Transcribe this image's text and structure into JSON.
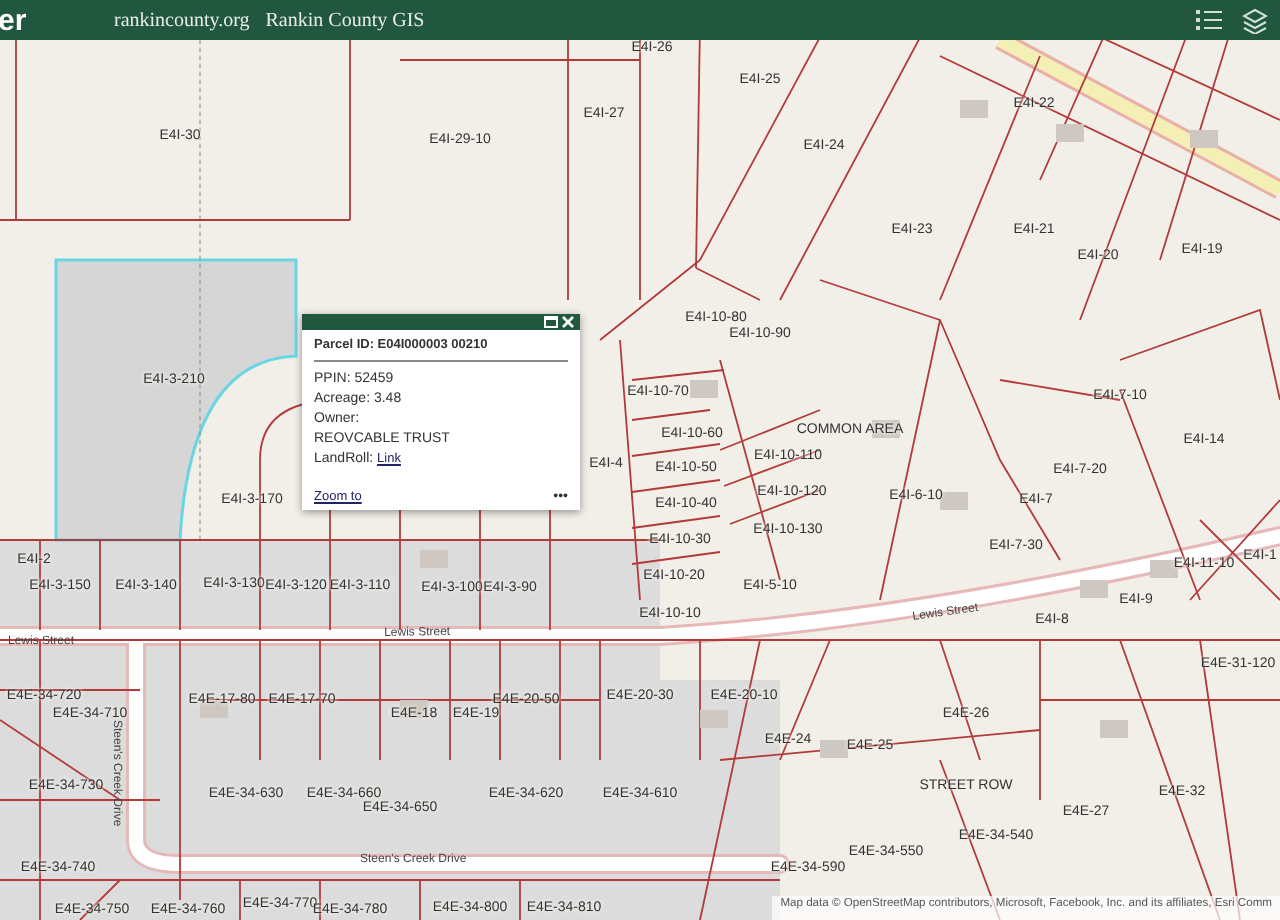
{
  "header": {
    "title_fragment": "er",
    "links": [
      "rankincounty.org",
      "Rankin County GIS"
    ]
  },
  "map": {
    "parcel_labels": [
      "E4I-30",
      "E4I-29-10",
      "E4I-27",
      "E4I-26",
      "E4I-25",
      "E4I-24",
      "E4I-22",
      "E4I-23",
      "E4I-21",
      "E4I-20",
      "E4I-19",
      "E4I-3-210",
      "E4I-10-80",
      "E4I-10-90",
      "E4I-10-70",
      "E4I-7-10",
      "E4I-14",
      "E4I-10-60",
      "COMMON AREA",
      "E4I-10-50",
      "E4I-10-110",
      "E4I-4",
      "E4I-6-10",
      "E4I-7-20",
      "E4I-7",
      "E4I-10-120",
      "E4I-3-170",
      "E4I-2",
      "E4I-10-40",
      "E4I-10-30",
      "E4I-10-130",
      "E4I-7-30",
      "E4I-11-10",
      "E4I-1",
      "E4I-10-20",
      "E4I-5-10",
      "E4I-9",
      "E4I-3-150",
      "E4I-3-140",
      "E4I-3-130",
      "E4I-3-120",
      "E4I-3-110",
      "E4I-3-100",
      "E4I-3-90",
      "E4I-10-10",
      "E4I-8",
      "E4E-34-720",
      "E4E-34-710",
      "E4E-17-80",
      "E4E-17-70",
      "E4E-18",
      "E4E-19",
      "E4E-20-50",
      "E4E-20-30",
      "E4E-20-10",
      "E4E-24",
      "E4E-25",
      "E4E-26",
      "E4E-31-120",
      "E4E-34-730",
      "E4E-34-630",
      "E4E-34-660",
      "E4E-34-650",
      "E4E-34-620",
      "E4E-34-610",
      "STREET ROW",
      "E4E-27",
      "E4E-32",
      "E4E-34-540",
      "E4E-34-550",
      "E4E-34-740",
      "E4E-34-590",
      "E4E-34-750",
      "E4E-34-760",
      "E4E-34-770",
      "E4E-34-780",
      "E4E-34-800",
      "E4E-34-810"
    ],
    "street_labels": [
      "Lewis Street",
      "Lewis Street",
      "Lewis Street",
      "Steen's Creek Drive",
      "Steen's Creek Drive"
    ]
  },
  "popup": {
    "title": "Parcel ID: E04I000003 00210",
    "fields": [
      "PPIN: 52459",
      "Acreage: 3.48",
      "Owner:",
      "REOVCABLE TRUST"
    ],
    "link_label": "LandRoll:",
    "link": "Link",
    "zoom_link": "Zoom to",
    "more": "•••"
  },
  "attribution": "Map data © OpenStreetMap contributors, Microsoft, Facebook, Inc. and its affiliates, Esri Comm"
}
